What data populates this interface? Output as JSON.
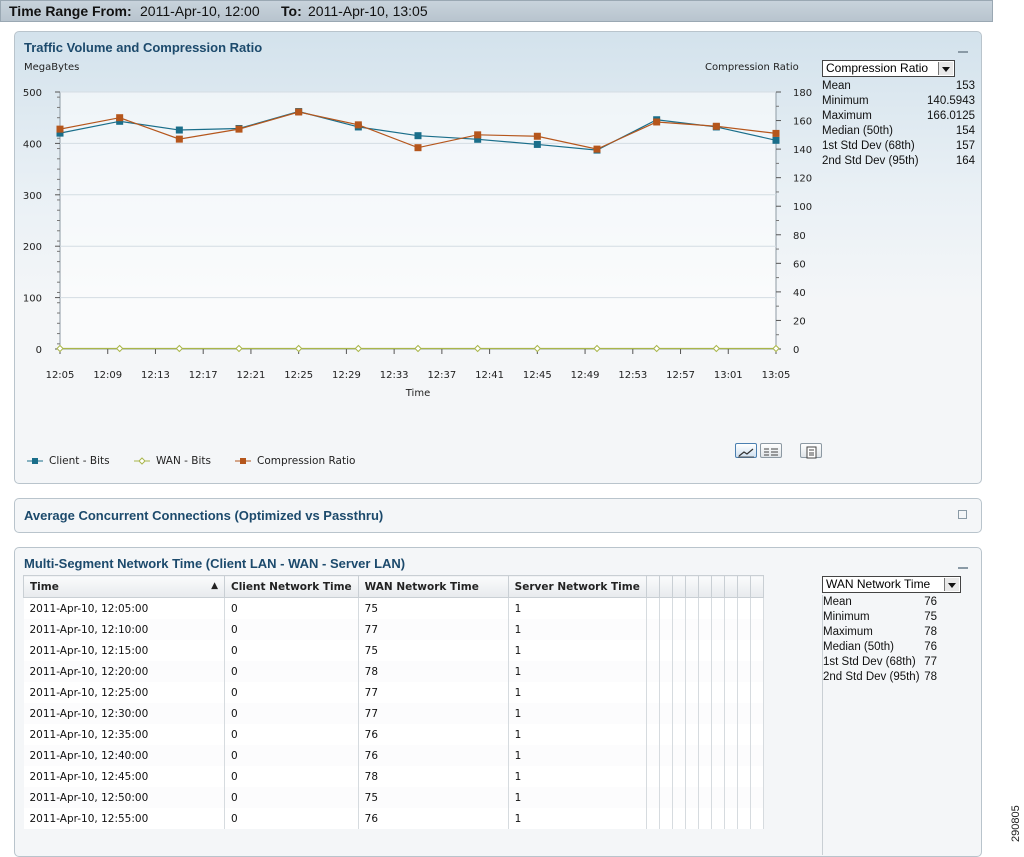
{
  "header": {
    "from_label": "Time Range From:",
    "from_value": "2011-Apr-10, 12:00",
    "to_label": "To:",
    "to_value": "2011-Apr-10, 13:05"
  },
  "traffic_panel": {
    "title": "Traffic Volume and Compression Ratio",
    "left_axis_label": "MegaBytes",
    "right_axis_label": "Compression Ratio",
    "x_axis_label": "Time",
    "metric_select": "Compression Ratio",
    "stats": [
      {
        "label": "Mean",
        "value": "153"
      },
      {
        "label": "Minimum",
        "value": "140.5943"
      },
      {
        "label": "Maximum",
        "value": "166.0125"
      },
      {
        "label": "Median (50th)",
        "value": "154"
      },
      {
        "label": "1st Std Dev (68th)",
        "value": "157"
      },
      {
        "label": "2nd Std Dev (95th)",
        "value": "164"
      }
    ],
    "legend": [
      {
        "label": "Client - Bits",
        "color": "#1a6e8a",
        "marker": "square"
      },
      {
        "label": "WAN - Bits",
        "color": "#a9b64a",
        "marker": "diamond"
      },
      {
        "label": "Compression Ratio",
        "color": "#b5561c",
        "marker": "square"
      }
    ],
    "buttons": [
      "chart-view",
      "table-view",
      "export"
    ]
  },
  "chart_data": {
    "type": "line",
    "x": [
      "12:05",
      "12:09",
      "12:13",
      "12:17",
      "12:21",
      "12:25",
      "12:29",
      "12:33",
      "12:37",
      "12:41",
      "12:45",
      "12:49",
      "12:53",
      "12:57",
      "13:01",
      "13:05"
    ],
    "x_ticks": [
      "12:05",
      "12:09",
      "12:13",
      "12:17",
      "12:21",
      "12:25",
      "12:29",
      "12:33",
      "12:37",
      "12:41",
      "12:45",
      "12:49",
      "12:53",
      "12:57",
      "13:01",
      "13:05"
    ],
    "xlabel": "Time",
    "ylabel": "MegaBytes",
    "ylim": [
      0,
      500
    ],
    "y_ticks": [
      0,
      100,
      200,
      300,
      400,
      500
    ],
    "y2label": "Compression Ratio",
    "y2lim": [
      0,
      180
    ],
    "y2_ticks": [
      0,
      20,
      40,
      60,
      80,
      100,
      120,
      140,
      160,
      180
    ],
    "grid": true,
    "series": [
      {
        "name": "Client - Bits",
        "axis": "left",
        "color": "#1a6e8a",
        "x_minutes": [
          "12:05",
          "12:10",
          "12:15",
          "12:20",
          "12:25",
          "12:30",
          "12:35",
          "12:40",
          "12:45",
          "12:50",
          "12:55",
          "13:00",
          "13:05"
        ],
        "values": [
          420,
          443,
          426,
          429,
          462,
          432,
          415,
          408,
          398,
          387,
          446,
          432,
          406
        ]
      },
      {
        "name": "WAN - Bits",
        "axis": "left",
        "color": "#a9b64a",
        "x_minutes": [
          "12:05",
          "12:10",
          "12:15",
          "12:20",
          "12:25",
          "12:30",
          "12:35",
          "12:40",
          "12:45",
          "12:50",
          "12:55",
          "13:00",
          "13:05"
        ],
        "values": [
          1,
          1,
          1,
          1,
          1,
          1,
          1,
          1,
          1,
          1,
          1,
          1,
          1
        ]
      },
      {
        "name": "Compression Ratio",
        "axis": "right",
        "color": "#b5561c",
        "x_minutes": [
          "12:05",
          "12:10",
          "12:15",
          "12:20",
          "12:25",
          "12:30",
          "12:35",
          "12:40",
          "12:45",
          "12:50",
          "12:55",
          "13:00",
          "13:05"
        ],
        "values": [
          154,
          162,
          147,
          154,
          166,
          157,
          141,
          150,
          149,
          140,
          159,
          156,
          151
        ]
      }
    ]
  },
  "connections_panel": {
    "title": "Average Concurrent Connections (Optimized vs Passthru)"
  },
  "network_panel": {
    "title": "Multi-Segment Network Time (Client LAN - WAN - Server LAN)",
    "metric_select": "WAN Network Time",
    "columns": [
      "Time",
      "Client Network Time",
      "WAN Network Time",
      "Server Network Time"
    ],
    "rows": [
      [
        "2011-Apr-10, 12:05:00",
        "0",
        "75",
        "1"
      ],
      [
        "2011-Apr-10, 12:10:00",
        "0",
        "77",
        "1"
      ],
      [
        "2011-Apr-10, 12:15:00",
        "0",
        "75",
        "1"
      ],
      [
        "2011-Apr-10, 12:20:00",
        "0",
        "78",
        "1"
      ],
      [
        "2011-Apr-10, 12:25:00",
        "0",
        "77",
        "1"
      ],
      [
        "2011-Apr-10, 12:30:00",
        "0",
        "77",
        "1"
      ],
      [
        "2011-Apr-10, 12:35:00",
        "0",
        "76",
        "1"
      ],
      [
        "2011-Apr-10, 12:40:00",
        "0",
        "76",
        "1"
      ],
      [
        "2011-Apr-10, 12:45:00",
        "0",
        "78",
        "1"
      ],
      [
        "2011-Apr-10, 12:50:00",
        "0",
        "75",
        "1"
      ],
      [
        "2011-Apr-10, 12:55:00",
        "0",
        "76",
        "1"
      ]
    ],
    "stats": [
      {
        "label": "Mean",
        "value": "76"
      },
      {
        "label": "Minimum",
        "value": "75"
      },
      {
        "label": "Maximum",
        "value": "78"
      },
      {
        "label": "Median (50th)",
        "value": "76"
      },
      {
        "label": "1st Std Dev (68th)",
        "value": "77"
      },
      {
        "label": "2nd Std Dev (95th)",
        "value": "78"
      }
    ]
  },
  "figure_id": "290805"
}
